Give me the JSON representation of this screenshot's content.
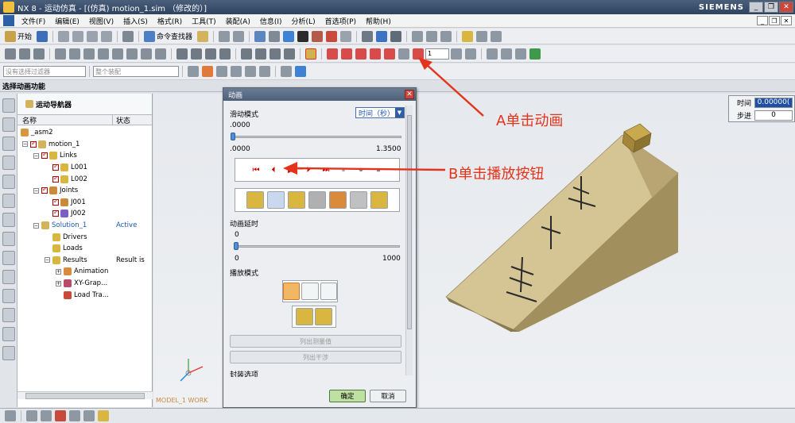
{
  "window": {
    "title": "NX 8 - 运动仿真 - [(仿真) motion_1.sim （修改的）]",
    "brand": "SIEMENS",
    "controls": [
      "_",
      "❐",
      "✕"
    ]
  },
  "menu": {
    "items": [
      "文件(F)",
      "编辑(E)",
      "视图(V)",
      "插入(S)",
      "格式(R)",
      "工具(T)",
      "装配(A)",
      "信息(I)",
      "分析(L)",
      "首选项(P)",
      "帮助(H)"
    ],
    "controls": [
      "_",
      "❐",
      "✕"
    ]
  },
  "toolbar": {
    "start_label": "开始",
    "command_finder_label": "命令查找器",
    "filter_placeholder": "没有选择过滤器",
    "assembly_placeholder": "整个装配",
    "step_value": "1"
  },
  "select_bar": {
    "label": "选择动画功能"
  },
  "navigator": {
    "title": "运动导航器",
    "columns": [
      "名称",
      "状态"
    ],
    "rows": [
      {
        "label": "_asm2",
        "status": ""
      },
      {
        "label": "motion_1",
        "status": ""
      },
      {
        "label": "Links",
        "status": ""
      },
      {
        "label": "L001",
        "status": ""
      },
      {
        "label": "L002",
        "status": ""
      },
      {
        "label": "Joints",
        "status": ""
      },
      {
        "label": "J001",
        "status": ""
      },
      {
        "label": "J002",
        "status": ""
      },
      {
        "label": "Solution_1",
        "status": "Active"
      },
      {
        "label": "Drivers",
        "status": ""
      },
      {
        "label": "Loads",
        "status": ""
      },
      {
        "label": "Results",
        "status": "Result is"
      },
      {
        "label": "Animation",
        "status": ""
      },
      {
        "label": "XY-Grap...",
        "status": ""
      },
      {
        "label": "Load Tra...",
        "status": ""
      }
    ]
  },
  "dialog": {
    "title": "动画",
    "slide_mode_label": "滑动模式",
    "slide_mode_value": "时间（秒）",
    "time_value": ".0000",
    "time_min": ".0000",
    "time_max": "1.3500",
    "delay_label": "动画延时",
    "delay_value": "0",
    "delay_min": "0",
    "delay_max": "1000",
    "playback_label": "播放模式",
    "list_measure_label": "列出测量值",
    "list_interference_label": "列出干涉",
    "package_options_label": "封装选项",
    "ok_label": "确定",
    "cancel_label": "取消"
  },
  "time_panel": {
    "time_label": "时间",
    "time_value": "0.00000(",
    "step_label": "步进",
    "step_value": "0"
  },
  "annotations": {
    "a_text": "A单击动画",
    "b_text": "B单击播放按钮",
    "color": "#e5331b"
  },
  "graphics": {
    "wcs_label": "MODEL_1 WORK"
  }
}
